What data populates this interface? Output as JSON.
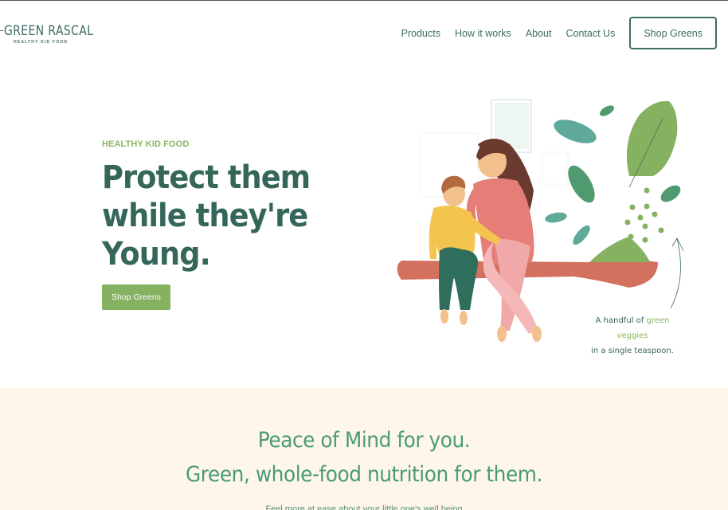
{
  "header": {
    "logo": {
      "name": "GREEN RASCAL",
      "tagline": "HEALTHY KID FOOD"
    },
    "nav": [
      {
        "label": "Products"
      },
      {
        "label": "How it works"
      },
      {
        "label": "About"
      },
      {
        "label": "Contact Us"
      }
    ],
    "cta_label": "Shop Greens"
  },
  "hero": {
    "eyebrow": "HEALTHY KID FOOD",
    "title_lines": [
      "Protect them",
      "while they're",
      "Young."
    ],
    "button_label": "Shop Greens",
    "caption": {
      "part1": "A handful of ",
      "green": "green veggies",
      "line2": "in a single teaspoon."
    }
  },
  "section2": {
    "heading_line1": "Peace of Mind for you.",
    "heading_line2": "Green, whole-food nutrition for them.",
    "subtext": "Feel more at ease about your little one's well being"
  },
  "colors": {
    "primary": "#35665a",
    "accent_green": "#86b160",
    "cream": "#fef7e9",
    "teal_heading": "#4a9a78"
  }
}
